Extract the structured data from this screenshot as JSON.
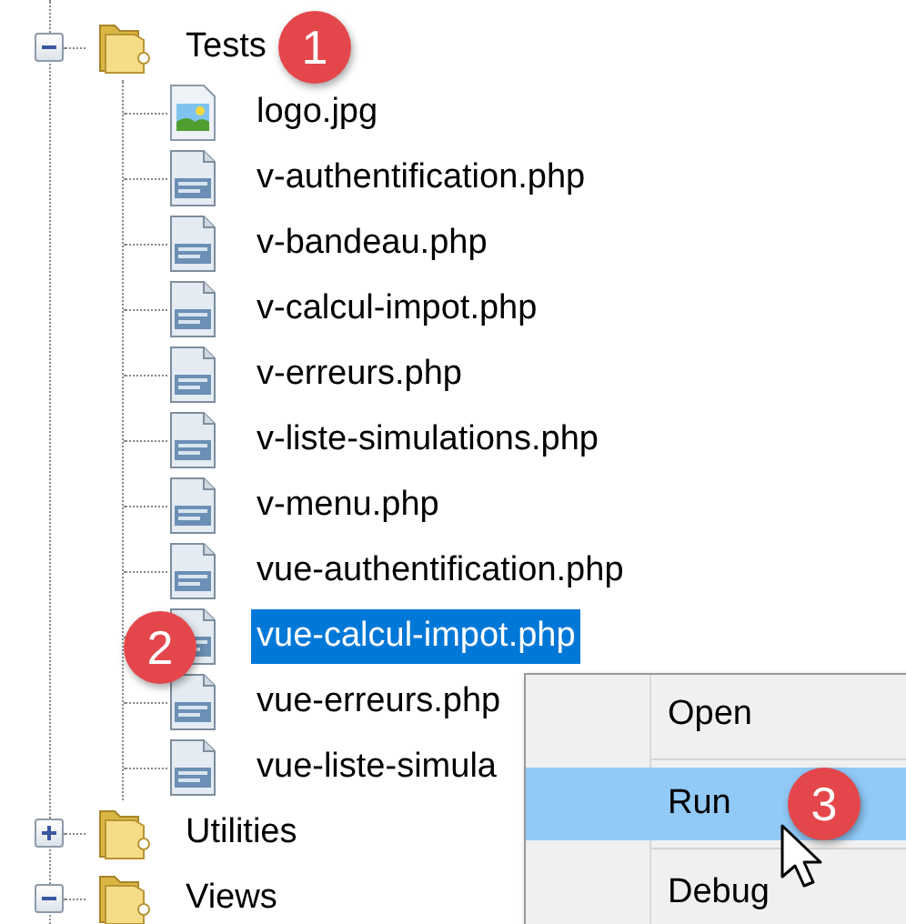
{
  "tree": [
    {
      "label": "Tests",
      "expanded": true,
      "selected": false,
      "children": [
        {
          "label": "logo.jpg",
          "kind": "image",
          "selected": false
        },
        {
          "label": "v-authentification.php",
          "kind": "php",
          "selected": false
        },
        {
          "label": "v-bandeau.php",
          "kind": "php",
          "selected": false
        },
        {
          "label": "v-calcul-impot.php",
          "kind": "php",
          "selected": false
        },
        {
          "label": "v-erreurs.php",
          "kind": "php",
          "selected": false
        },
        {
          "label": "v-liste-simulations.php",
          "kind": "php",
          "selected": false
        },
        {
          "label": "v-menu.php",
          "kind": "php",
          "selected": false
        },
        {
          "label": "vue-authentification.php",
          "kind": "php",
          "selected": false
        },
        {
          "label": "vue-calcul-impot.php",
          "kind": "php",
          "selected": true
        },
        {
          "label": "vue-erreurs.php",
          "kind": "php",
          "selected": false
        },
        {
          "label": "vue-liste-simula",
          "kind": "php",
          "selected": false
        }
      ]
    },
    {
      "label": "Utilities",
      "expanded": false,
      "selected": false
    },
    {
      "label": "Views",
      "expanded": true,
      "selected": false
    }
  ],
  "context_menu": {
    "items": [
      {
        "label": "Open",
        "selected": false
      },
      {
        "label": "Run",
        "selected": true
      },
      {
        "label": "Debug",
        "selected": false
      }
    ]
  },
  "callouts": [
    "1",
    "2",
    "3"
  ]
}
